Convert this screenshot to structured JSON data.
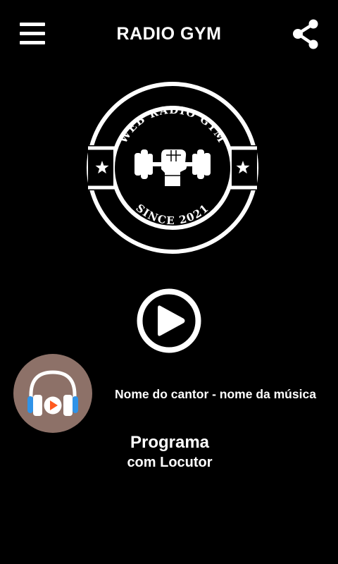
{
  "header": {
    "title": "RADIO GYM",
    "menu_icon": "hamburger-menu-icon",
    "share_icon": "share-icon"
  },
  "logo": {
    "top_text": "WEB RADIO GYM",
    "bottom_text": "SINCE 2021",
    "emblem_icon": "dumbbell-fist-icon"
  },
  "player": {
    "play_icon": "play-icon",
    "album_art_icon": "headphones-play-icon",
    "track_info": "Nome do cantor - nome da música"
  },
  "program": {
    "title": "Programa",
    "host": "com Locutor"
  },
  "colors": {
    "background": "#000000",
    "foreground": "#ffffff",
    "album_bg": "#8d7168",
    "headphone_blue": "#2f93e8",
    "play_accent": "#ff5a1f"
  }
}
